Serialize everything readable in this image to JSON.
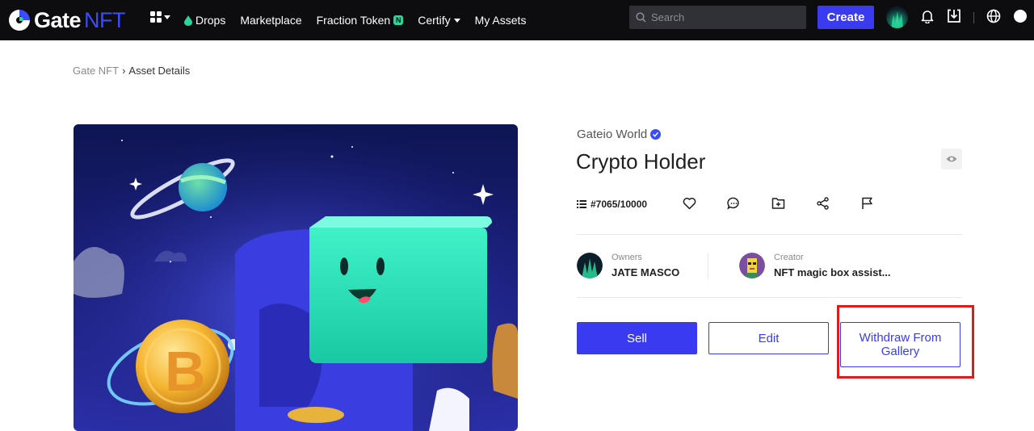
{
  "nav": {
    "logo_gate": "Gate",
    "logo_nft": "NFT",
    "menu": [
      {
        "label": "Drops",
        "icon": "drop-icon"
      },
      {
        "label": "Marketplace"
      },
      {
        "label": "Fraction Token",
        "badge": "N"
      },
      {
        "label": "Certify",
        "caret": true
      },
      {
        "label": "My Assets"
      }
    ],
    "search_placeholder": "Search",
    "create_label": "Create"
  },
  "breadcrumb": {
    "root": "Gate NFT",
    "current": "Asset Details"
  },
  "asset": {
    "collection": "Gateio World",
    "title": "Crypto Holder",
    "edition": "#7065/10000",
    "owner_label": "Owners",
    "owner_name": "JATE MASCO",
    "creator_label": "Creator",
    "creator_name": "NFT magic box assist..."
  },
  "actions": {
    "sell": "Sell",
    "edit": "Edit",
    "withdraw": "Withdraw From Gallery"
  },
  "colors": {
    "accent": "#3a3af0",
    "nav_bg": "#0d0d0f",
    "highlight": "#e01b1b",
    "badge": "#2bd69b"
  }
}
